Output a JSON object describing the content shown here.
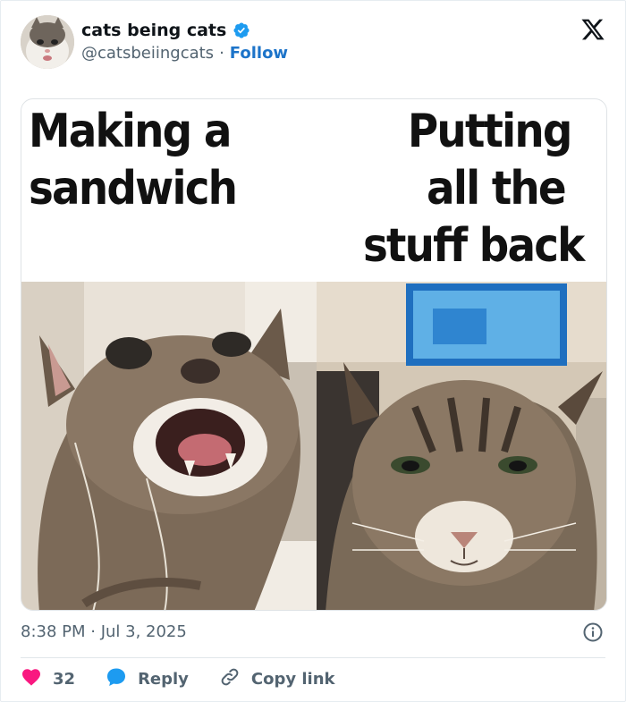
{
  "account": {
    "display_name": "cats being cats",
    "handle": "@catsbeiingcats",
    "separator": "·",
    "follow_label": "Follow"
  },
  "media": {
    "left_caption_line1": "Making a",
    "left_caption_line2": "sandwich",
    "right_caption_line1": "Putting",
    "right_caption_line2": "all the",
    "right_caption_line3": "stuff back"
  },
  "tweet": {
    "timestamp": "8:38 PM · Jul 3, 2025"
  },
  "actions": {
    "like_count": "32",
    "reply_label": "Reply",
    "copy_link_label": "Copy link"
  },
  "colors": {
    "like": "#f91880",
    "reply": "#1d9bf0",
    "follow": "#1d74c9",
    "muted": "#536471"
  }
}
